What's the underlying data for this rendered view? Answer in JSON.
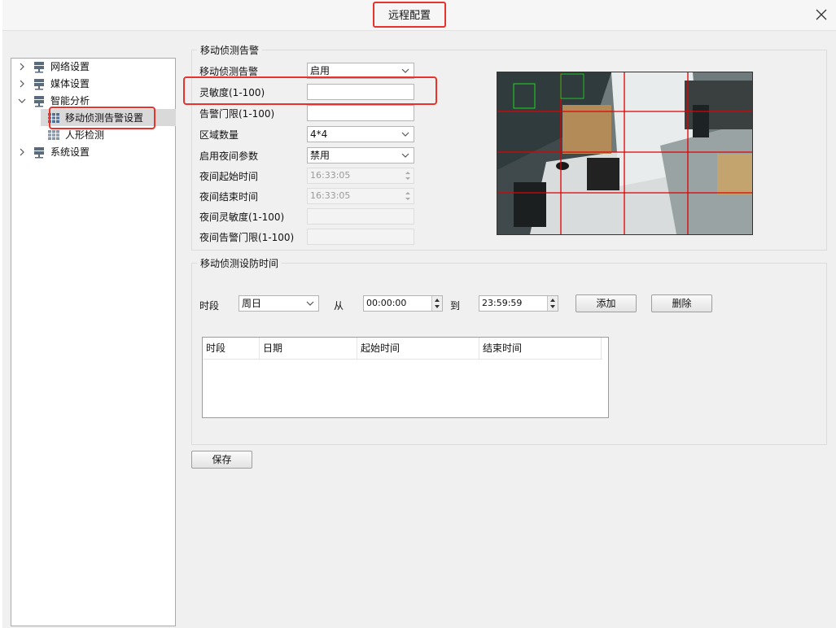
{
  "window": {
    "title": "远程配置"
  },
  "tree": [
    {
      "label": "网络设置",
      "expanded": false,
      "level": 0
    },
    {
      "label": "媒体设置",
      "expanded": false,
      "level": 0
    },
    {
      "label": "智能分析",
      "expanded": true,
      "level": 0
    },
    {
      "label": "移动侦测告警设置",
      "level": 1,
      "selected": true
    },
    {
      "label": "人形检测",
      "level": 1
    },
    {
      "label": "系统设置",
      "expanded": false,
      "level": 0
    }
  ],
  "motion": {
    "section_title": "移动侦测告警",
    "alarm_label": "移动侦测告警",
    "alarm_value": "启用",
    "sensitivity_label": "灵敏度(1-100)",
    "sensitivity_value": "",
    "threshold_label": "告警门限(1-100)",
    "threshold_value": "",
    "region_label": "区域数量",
    "region_value": "4*4",
    "night_enable_label": "启用夜间参数",
    "night_enable_value": "禁用",
    "night_start_label": "夜间起始时间",
    "night_start_value": "16:33:05",
    "night_end_label": "夜间结束时间",
    "night_end_value": "16:33:05",
    "night_sens_label": "夜间灵敏度(1-100)",
    "night_threshold_label": "夜间告警门限(1-100)"
  },
  "schedule": {
    "section_title": "移动侦测设防时间",
    "period_label": "时段",
    "day_value": "周日",
    "from_label": "从",
    "from_value": "00:00:00",
    "to_label": "到",
    "to_value": "23:59:59",
    "add_label": "添加",
    "delete_label": "删除",
    "columns": [
      "时段",
      "日期",
      "起始时间",
      "结束时间"
    ]
  },
  "save_label": "保存",
  "colors": {
    "highlight": "#e8322b",
    "grid_line": "#e00000"
  }
}
